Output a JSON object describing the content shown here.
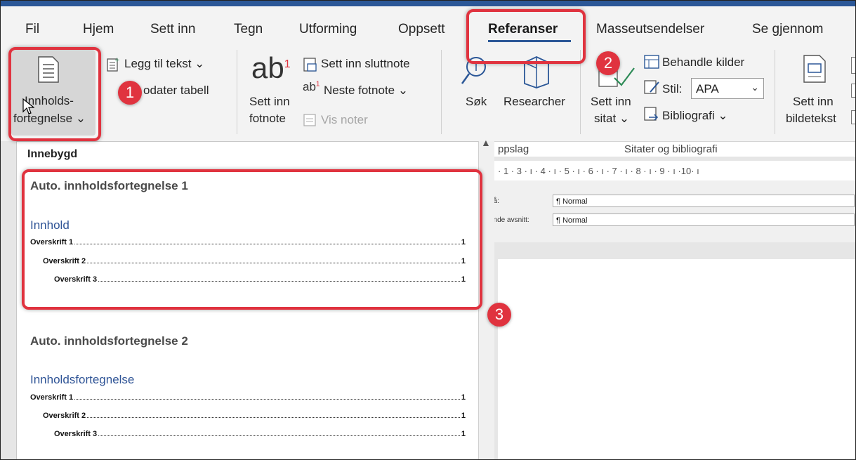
{
  "tabs": [
    "Fil",
    "Hjem",
    "Sett inn",
    "Tegn",
    "Utforming",
    "Oppsett",
    "Referanser",
    "Masseutsendelser",
    "Se gjennom"
  ],
  "active_tab": "Referanser",
  "ribbon": {
    "toc_button": {
      "line1": "Innholds-",
      "line2": "fortegnelse ⌄"
    },
    "add_text": "Legg til tekst ⌄",
    "update_table": "odater tabell",
    "insert_footnote": {
      "line1": "Sett inn",
      "line2": "fotnote"
    },
    "insert_endnote": "Sett inn sluttnote",
    "next_footnote": "Neste fotnote ⌄",
    "show_notes": "Vis noter",
    "search": "Søk",
    "researcher": "Researcher",
    "lookup_group": "ppslag",
    "insert_citation": {
      "line1": "Sett inn",
      "line2": "sitat ⌄"
    },
    "manage_sources": "Behandle kilder",
    "style_label": "Stil:",
    "style_value": "APA",
    "bibliography": "Bibliografi ⌄",
    "citations_group": "Sitater og bibliografi",
    "insert_caption": {
      "line1": "Sett inn",
      "line2": "bildetekst"
    }
  },
  "badges": [
    "1",
    "2",
    "3"
  ],
  "ruler_text": "· 1 · 3 · ı · 4 · ı · 5 · ı · 6 · ı · 7 · ı · 8 · ı · 9 · ı ·10· ı",
  "style_form": {
    "row1_label": "på:",
    "row1_value": "¶ Normal",
    "row2_label": "ende avsnitt:",
    "row2_value": "¶ Normal"
  },
  "gallery": {
    "header": "Innebygd",
    "items": [
      {
        "title": "Auto. innholdsfortegnelse 1",
        "heading": "Innhold",
        "entries": [
          {
            "label": "Overskrift 1",
            "page": "1"
          },
          {
            "label": "Overskrift 2",
            "page": "1"
          },
          {
            "label": "Overskrift 3",
            "page": "1"
          }
        ]
      },
      {
        "title": "Auto. innholdsfortegnelse 2",
        "heading": "Innholdsfortegnelse",
        "entries": [
          {
            "label": "Overskrift 1",
            "page": "1"
          },
          {
            "label": "Overskrift 2",
            "page": "1"
          },
          {
            "label": "Overskrift 3",
            "page": "1"
          }
        ]
      }
    ]
  },
  "colors": {
    "accent": "#2b5797",
    "callout": "#e0333f",
    "heading_blue": "#2f5496"
  }
}
